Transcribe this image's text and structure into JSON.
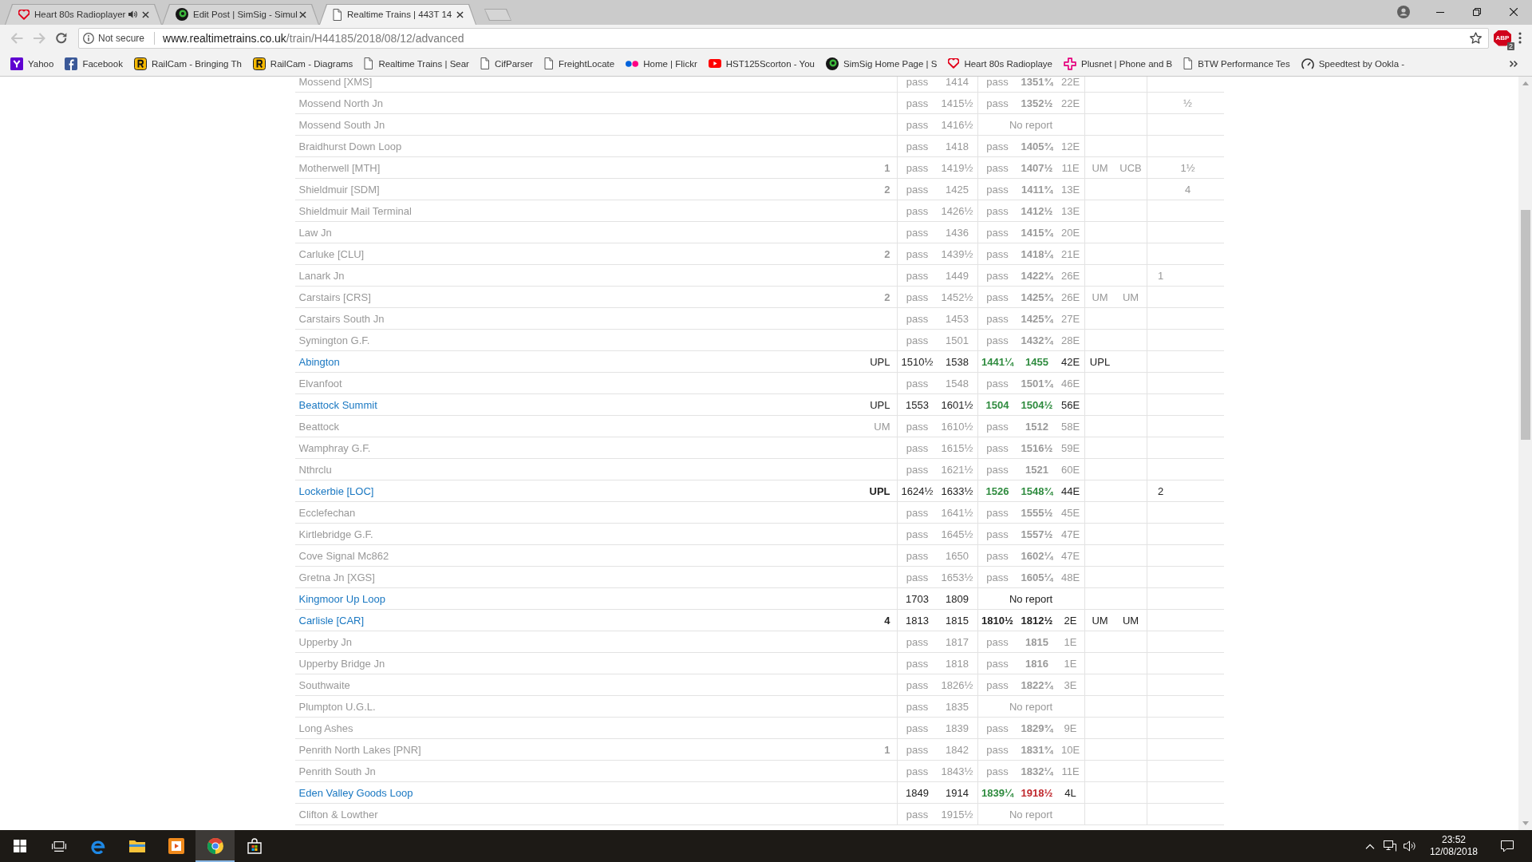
{
  "window": {
    "tabs": [
      {
        "title": "Heart 80s Radioplayer",
        "selected": false,
        "audible": true
      },
      {
        "title": "Edit Post | SimSig - Simul",
        "selected": false,
        "audible": false
      },
      {
        "title": "Realtime Trains | 443T 14",
        "selected": true,
        "audible": false
      }
    ]
  },
  "toolbar": {
    "back": {
      "disabled": true
    },
    "forward": {
      "disabled": true
    },
    "security": "Not secure",
    "url": {
      "host": "www.realtimetrains.co.uk",
      "path": "/train/H44185/2018/08/12/advanced"
    },
    "extension": {
      "label": "ABP",
      "badge": "2"
    }
  },
  "bookmarks": [
    "Yahoo",
    "Facebook",
    "RailCam - Bringing Th",
    "RailCam - Diagrams",
    "Realtime Trains | Sear",
    "CifParser",
    "FreightLocate",
    "Home | Flickr",
    "HST125Scorton - You",
    "SimSig Home Page | S",
    "Heart 80s Radioplaye",
    "Plusnet | Phone and B",
    "BTW Performance Tes",
    "Speedtest by Ookla -"
  ],
  "table": {
    "rows": [
      {
        "location": "Mossend [XMS]",
        "kind": "pass",
        "column_3": "pass",
        "column_4": "1414",
        "column_5": {
          "text": "pass",
          "bold": false,
          "color": "#999999"
        },
        "column_6": {
          "text": "1351¾",
          "bold": true,
          "color": "#999999"
        },
        "column_7": "22E"
      },
      {
        "location": "Mossend North Jn",
        "kind": "pass",
        "column_3": "pass",
        "column_4": "1415½",
        "column_5": {
          "text": "pass",
          "bold": false,
          "color": "#999999"
        },
        "column_6": {
          "text": "1352½",
          "bold": true,
          "color": "#999999"
        },
        "column_7": "22E",
        "column_11": "½"
      },
      {
        "location": "Mossend South Jn",
        "kind": "pass",
        "column_3": "pass",
        "column_4": "1416½",
        "column_5_to_7": "No report"
      },
      {
        "location": "Braidhurst Down Loop",
        "kind": "pass",
        "column_3": "pass",
        "column_4": "1418",
        "column_5": {
          "text": "pass",
          "bold": false,
          "color": "#999999"
        },
        "column_6": {
          "text": "1405¾",
          "bold": true,
          "color": "#999999"
        },
        "column_7": "12E"
      },
      {
        "location": "Motherwell [MTH]",
        "kind": "pass",
        "column_2": {
          "text": "1",
          "bold": true
        },
        "column_3": "pass",
        "column_4": "1419½",
        "column_5": {
          "text": "pass",
          "bold": false,
          "color": "#999999"
        },
        "column_6": {
          "text": "1407½",
          "bold": true,
          "color": "#999999"
        },
        "column_7": "11E",
        "column_8": "UM",
        "column_9": "UCB",
        "column_11": "1½"
      },
      {
        "location": "Shieldmuir [SDM]",
        "kind": "pass",
        "column_2": {
          "text": "2",
          "bold": true
        },
        "column_3": "pass",
        "column_4": "1425",
        "column_5": {
          "text": "pass",
          "bold": false,
          "color": "#999999"
        },
        "column_6": {
          "text": "1411¾",
          "bold": true,
          "color": "#999999"
        },
        "column_7": "13E",
        "column_11": "4"
      },
      {
        "location": "Shieldmuir Mail Terminal",
        "kind": "pass",
        "column_3": "pass",
        "column_4": "1426½",
        "column_5": {
          "text": "pass",
          "bold": false,
          "color": "#999999"
        },
        "column_6": {
          "text": "1412½",
          "bold": true,
          "color": "#999999"
        },
        "column_7": "13E"
      },
      {
        "location": "Law Jn",
        "kind": "pass",
        "column_3": "pass",
        "column_4": "1436",
        "column_5": {
          "text": "pass",
          "bold": false,
          "color": "#999999"
        },
        "column_6": {
          "text": "1415¾",
          "bold": true,
          "color": "#999999"
        },
        "column_7": "20E"
      },
      {
        "location": "Carluke [CLU]",
        "kind": "pass",
        "column_2": {
          "text": "2",
          "bold": true
        },
        "column_3": "pass",
        "column_4": "1439½",
        "column_5": {
          "text": "pass",
          "bold": false,
          "color": "#999999"
        },
        "column_6": {
          "text": "1418¼",
          "bold": true,
          "color": "#999999"
        },
        "column_7": "21E"
      },
      {
        "location": "Lanark Jn",
        "kind": "pass",
        "column_3": "pass",
        "column_4": "1449",
        "column_5": {
          "text": "pass",
          "bold": false,
          "color": "#999999"
        },
        "column_6": {
          "text": "1422¾",
          "bold": true,
          "color": "#999999"
        },
        "column_7": "26E",
        "column_10": "1"
      },
      {
        "location": "Carstairs [CRS]",
        "kind": "pass",
        "column_2": {
          "text": "2",
          "bold": true
        },
        "column_3": "pass",
        "column_4": "1452½",
        "column_5": {
          "text": "pass",
          "bold": false,
          "color": "#999999"
        },
        "column_6": {
          "text": "1425¾",
          "bold": true,
          "color": "#999999"
        },
        "column_7": "26E",
        "column_8": "UM",
        "column_9": "UM"
      },
      {
        "location": "Carstairs South Jn",
        "kind": "pass",
        "column_3": "pass",
        "column_4": "1453",
        "column_5": {
          "text": "pass",
          "bold": false,
          "color": "#999999"
        },
        "column_6": {
          "text": "1425¾",
          "bold": true,
          "color": "#999999"
        },
        "column_7": "27E"
      },
      {
        "location": "Symington G.F.",
        "kind": "pass",
        "column_3": "pass",
        "column_4": "1501",
        "column_5": {
          "text": "pass",
          "bold": false,
          "color": "#999999"
        },
        "column_6": {
          "text": "1432¾",
          "bold": true,
          "color": "#999999"
        },
        "column_7": "28E"
      },
      {
        "location": "Abington",
        "kind": "call",
        "column_2": {
          "text": "UPL",
          "bold": false
        },
        "column_3": "1510½",
        "column_4": "1538",
        "column_5": {
          "text": "1441¼",
          "bold": true,
          "color": "#2e8b3e"
        },
        "column_6": {
          "text": "1455",
          "bold": true,
          "color": "#2e8b3e"
        },
        "column_7": "42E",
        "column_8": "UPL"
      },
      {
        "location": "Elvanfoot",
        "kind": "pass",
        "column_3": "pass",
        "column_4": "1548",
        "column_5": {
          "text": "pass",
          "bold": false,
          "color": "#999999"
        },
        "column_6": {
          "text": "1501¾",
          "bold": true,
          "color": "#999999"
        },
        "column_7": "46E"
      },
      {
        "location": "Beattock Summit",
        "kind": "call",
        "column_2": {
          "text": "UPL",
          "bold": false
        },
        "column_3": "1553",
        "column_4": "1601½",
        "column_5": {
          "text": "1504",
          "bold": true,
          "color": "#2e8b3e"
        },
        "column_6": {
          "text": "1504½",
          "bold": true,
          "color": "#2e8b3e"
        },
        "column_7": "56E"
      },
      {
        "location": "Beattock",
        "kind": "pass",
        "column_2": {
          "text": "UM",
          "bold": false
        },
        "column_3": "pass",
        "column_4": "1610½",
        "column_5": {
          "text": "pass",
          "bold": false,
          "color": "#999999"
        },
        "column_6": {
          "text": "1512",
          "bold": true,
          "color": "#999999"
        },
        "column_7": "58E"
      },
      {
        "location": "Wamphray G.F.",
        "kind": "pass",
        "column_3": "pass",
        "column_4": "1615½",
        "column_5": {
          "text": "pass",
          "bold": false,
          "color": "#999999"
        },
        "column_6": {
          "text": "1516½",
          "bold": true,
          "color": "#999999"
        },
        "column_7": "59E"
      },
      {
        "location": "Nthrclu",
        "kind": "pass",
        "column_3": "pass",
        "column_4": "1621½",
        "column_5": {
          "text": "pass",
          "bold": false,
          "color": "#999999"
        },
        "column_6": {
          "text": "1521",
          "bold": true,
          "color": "#999999"
        },
        "column_7": "60E"
      },
      {
        "location": "Lockerbie [LOC]",
        "kind": "call",
        "column_2": {
          "text": "UPL",
          "bold": true
        },
        "column_3": "1624½",
        "column_4": "1633½",
        "column_5": {
          "text": "1526",
          "bold": true,
          "color": "#2e8b3e"
        },
        "column_6": {
          "text": "1548¾",
          "bold": true,
          "color": "#2e8b3e"
        },
        "column_7": "44E",
        "column_10": "2"
      },
      {
        "location": "Ecclefechan",
        "kind": "pass",
        "column_3": "pass",
        "column_4": "1641½",
        "column_5": {
          "text": "pass",
          "bold": false,
          "color": "#999999"
        },
        "column_6": {
          "text": "1555½",
          "bold": true,
          "color": "#999999"
        },
        "column_7": "45E"
      },
      {
        "location": "Kirtlebridge G.F.",
        "kind": "pass",
        "column_3": "pass",
        "column_4": "1645½",
        "column_5": {
          "text": "pass",
          "bold": false,
          "color": "#999999"
        },
        "column_6": {
          "text": "1557½",
          "bold": true,
          "color": "#999999"
        },
        "column_7": "47E"
      },
      {
        "location": "Cove Signal Mc862",
        "kind": "pass",
        "column_3": "pass",
        "column_4": "1650",
        "column_5": {
          "text": "pass",
          "bold": false,
          "color": "#999999"
        },
        "column_6": {
          "text": "1602¼",
          "bold": true,
          "color": "#999999"
        },
        "column_7": "47E"
      },
      {
        "location": "Gretna Jn [XGS]",
        "kind": "pass",
        "column_3": "pass",
        "column_4": "1653½",
        "column_5": {
          "text": "pass",
          "bold": false,
          "color": "#999999"
        },
        "column_6": {
          "text": "1605¼",
          "bold": true,
          "color": "#999999"
        },
        "column_7": "48E"
      },
      {
        "location": "Kingmoor Up Loop",
        "kind": "call",
        "column_3": "1703",
        "column_4": "1809",
        "column_5_to_7": "No report"
      },
      {
        "location": "Carlisle [CAR]",
        "kind": "call",
        "column_2": {
          "text": "4",
          "bold": true
        },
        "column_3": "1813",
        "column_4": "1815",
        "column_5": {
          "text": "1810½",
          "bold": true,
          "color": "#222222"
        },
        "column_6": {
          "text": "1812½",
          "bold": true,
          "color": "#222222"
        },
        "column_7": "2E",
        "column_8": "UM",
        "column_9": "UM"
      },
      {
        "location": "Upperby Jn",
        "kind": "pass",
        "column_3": "pass",
        "column_4": "1817",
        "column_5": {
          "text": "pass",
          "bold": false,
          "color": "#999999"
        },
        "column_6": {
          "text": "1815",
          "bold": true,
          "color": "#999999"
        },
        "column_7": "1E"
      },
      {
        "location": "Upperby Bridge Jn",
        "kind": "pass",
        "column_3": "pass",
        "column_4": "1818",
        "column_5": {
          "text": "pass",
          "bold": false,
          "color": "#999999"
        },
        "column_6": {
          "text": "1816",
          "bold": true,
          "color": "#999999"
        },
        "column_7": "1E"
      },
      {
        "location": "Southwaite",
        "kind": "pass",
        "column_3": "pass",
        "column_4": "1826½",
        "column_5": {
          "text": "pass",
          "bold": false,
          "color": "#999999"
        },
        "column_6": {
          "text": "1822¾",
          "bold": true,
          "color": "#999999"
        },
        "column_7": "3E"
      },
      {
        "location": "Plumpton U.G.L.",
        "kind": "pass",
        "column_3": "pass",
        "column_4": "1835",
        "column_5_to_7": "No report"
      },
      {
        "location": "Long Ashes",
        "kind": "pass",
        "column_3": "pass",
        "column_4": "1839",
        "column_5": {
          "text": "pass",
          "bold": false,
          "color": "#999999"
        },
        "column_6": {
          "text": "1829¾",
          "bold": true,
          "color": "#999999"
        },
        "column_7": "9E"
      },
      {
        "location": "Penrith North Lakes [PNR]",
        "kind": "pass",
        "column_2": {
          "text": "1",
          "bold": true
        },
        "column_3": "pass",
        "column_4": "1842",
        "column_5": {
          "text": "pass",
          "bold": false,
          "color": "#999999"
        },
        "column_6": {
          "text": "1831¾",
          "bold": true,
          "color": "#999999"
        },
        "column_7": "10E"
      },
      {
        "location": "Penrith South Jn",
        "kind": "pass",
        "column_3": "pass",
        "column_4": "1843½",
        "column_5": {
          "text": "pass",
          "bold": false,
          "color": "#999999"
        },
        "column_6": {
          "text": "1832¼",
          "bold": true,
          "color": "#999999"
        },
        "column_7": "11E"
      },
      {
        "location": "Eden Valley Goods Loop",
        "kind": "call",
        "column_3": "1849",
        "column_4": "1914",
        "column_5": {
          "text": "1839¼",
          "bold": true,
          "color": "#2e8b3e"
        },
        "column_6": {
          "text": "1918½",
          "bold": true,
          "color": "#c0282d"
        },
        "column_7": "4L"
      },
      {
        "location": "Clifton & Lowther",
        "kind": "pass",
        "column_3": "pass",
        "column_4": "1915½",
        "column_5_to_7": "No report"
      }
    ]
  },
  "taskbar": {
    "apps": [
      {
        "active": false
      },
      {
        "active": false
      },
      {
        "active": false
      },
      {
        "active": true
      },
      {
        "active": false
      }
    ],
    "clock": {
      "time": "23:52",
      "date": "12/08/2018"
    }
  }
}
